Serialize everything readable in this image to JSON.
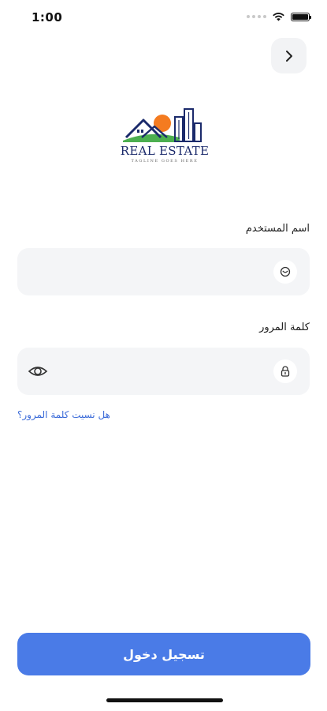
{
  "status_bar": {
    "time": "1:00",
    "icons": [
      "signal-icon",
      "wifi-icon",
      "battery-icon"
    ]
  },
  "header": {
    "back_icon": "chevron-right-icon"
  },
  "logo": {
    "title": "REAL ESTATE",
    "tagline": "TAGLINE GOES HERE",
    "colors": {
      "navy": "#1b2a6b",
      "sun": "#f47b20",
      "green": "#4caf50"
    }
  },
  "form": {
    "username": {
      "label": "اسم المستخدم",
      "value": "",
      "placeholder": "",
      "icon": "user-icon"
    },
    "password": {
      "label": "كلمة المرور",
      "value": "",
      "placeholder": "",
      "icon": "lock-icon",
      "toggle_icon": "eye-icon"
    },
    "forgot_password": "هل نسيت كلمة المرور؟"
  },
  "actions": {
    "login_label": "تسجيل دخول"
  },
  "colors": {
    "accent": "#4a7be7",
    "link": "#3a6ad8",
    "field_bg": "#f4f5f7"
  }
}
